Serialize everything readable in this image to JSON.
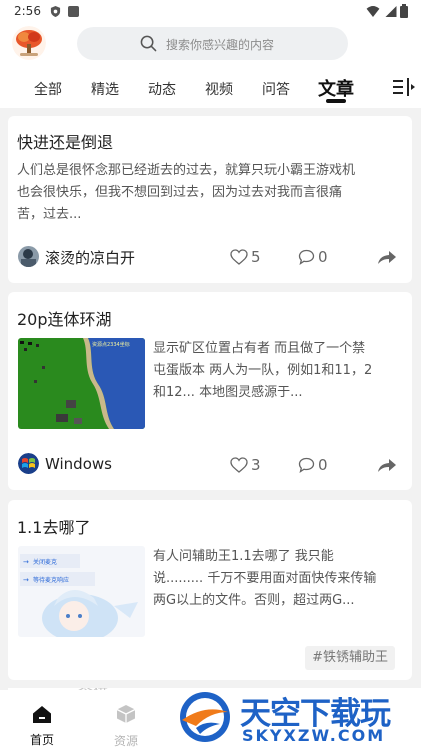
{
  "status_bar": {
    "time": "2:56"
  },
  "search": {
    "placeholder": "搜索你感兴趣的内容"
  },
  "tabs": [
    "全部",
    "精选",
    "动态",
    "视频",
    "问答",
    "文章"
  ],
  "active_tab": "文章",
  "posts": [
    {
      "title": "快进还是倒退",
      "excerpt_lines": [
        "人们总是很怀念那已经逝去的过去，就算只玩小霸王游戏机",
        "也会很快乐，但我不想回到过去，因为过去对我而言很痛",
        "苦，过去..."
      ],
      "author": "滚烫的凉白开",
      "likes": "5",
      "comments": "0"
    },
    {
      "title": "20p连体环湖",
      "excerpt_lines": [
        "显示矿区位置占有者 而且做了一个禁",
        "屯蛋版本 两人为一队，例如1和11，2",
        "和12... 本地图灵感源于..."
      ],
      "thumb_text": "资源点2334坐标",
      "author": "Windows",
      "likes": "3",
      "comments": "0"
    },
    {
      "title": "1.1去哪了",
      "excerpt_lines": [
        "有人问辅助王1.1去哪了 我只能",
        "说......... 千万不要用面对面快传来传输",
        "两G以上的文件。否则，超过两G..."
      ],
      "thumb_lines": [
        "关闭麦克",
        "等待麦克响应"
      ],
      "tag": "#铁锈辅助王"
    }
  ],
  "partial_author": "念猫",
  "bottom_nav": [
    {
      "label": "首页",
      "active": true
    },
    {
      "label": "资源",
      "active": false
    }
  ],
  "watermark": {
    "brand": "天空下载玩",
    "url": "SKYXZW.COM"
  },
  "colors": {
    "accent": "#1a1a1a",
    "watermark_blue": "#1e62c6",
    "watermark_orange": "#f07b1a"
  }
}
